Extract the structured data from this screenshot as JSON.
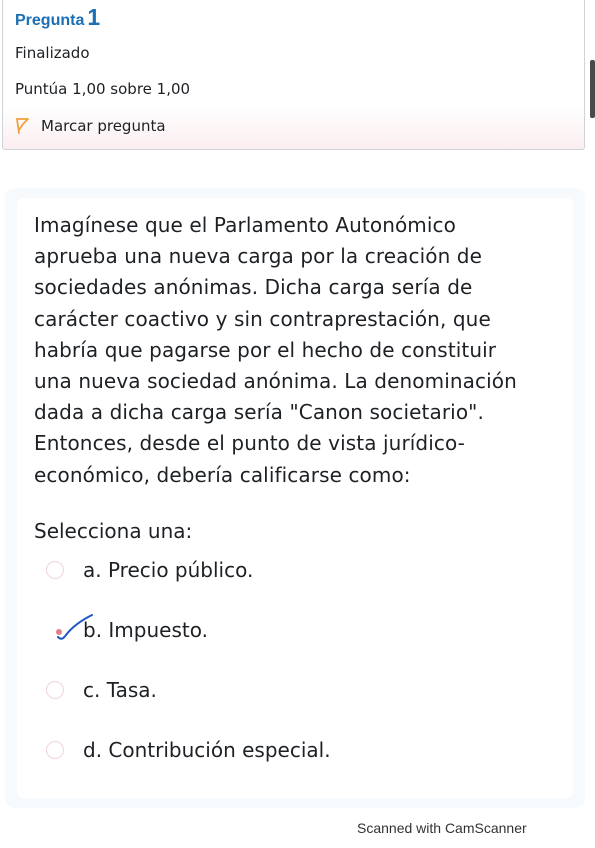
{
  "question_info": {
    "title_word": "Pregunta",
    "number": "1",
    "state": "Finalizado",
    "grade": "Puntúa 1,00 sobre 1,00",
    "flag_label": "Marcar pregunta"
  },
  "question": {
    "text_lines": [
      "Imagínese que el Parlamento Autonómico",
      "aprueba una nueva carga por la creación de",
      "sociedades anónimas. Dicha carga sería de",
      "carácter coactivo y sin contraprestación, que",
      "habría que pagarse por el hecho de constituir",
      "una nueva sociedad anónima. La denominación",
      "dada a dicha carga sería \"Canon societario\".",
      "Entonces, desde el punto de vista jurídico-",
      "económico, debería calificarse como:"
    ],
    "prompt": "Selecciona una:",
    "options": [
      {
        "label": "a. Precio público.",
        "selected": false
      },
      {
        "label": "b. Impuesto.",
        "selected": true
      },
      {
        "label": "c. Tasa.",
        "selected": false
      },
      {
        "label": "d. Contribución especial.",
        "selected": false
      }
    ]
  },
  "watermark": "Scanned with CamScanner",
  "colors": {
    "title_blue": "#1a6fb5",
    "flag_orange": "#f0a13c",
    "check_blue": "#1f57c4",
    "radio_border": "#f0d4d8"
  },
  "icons": {
    "flag": "flag-icon",
    "check": "handwritten-check-mark"
  }
}
